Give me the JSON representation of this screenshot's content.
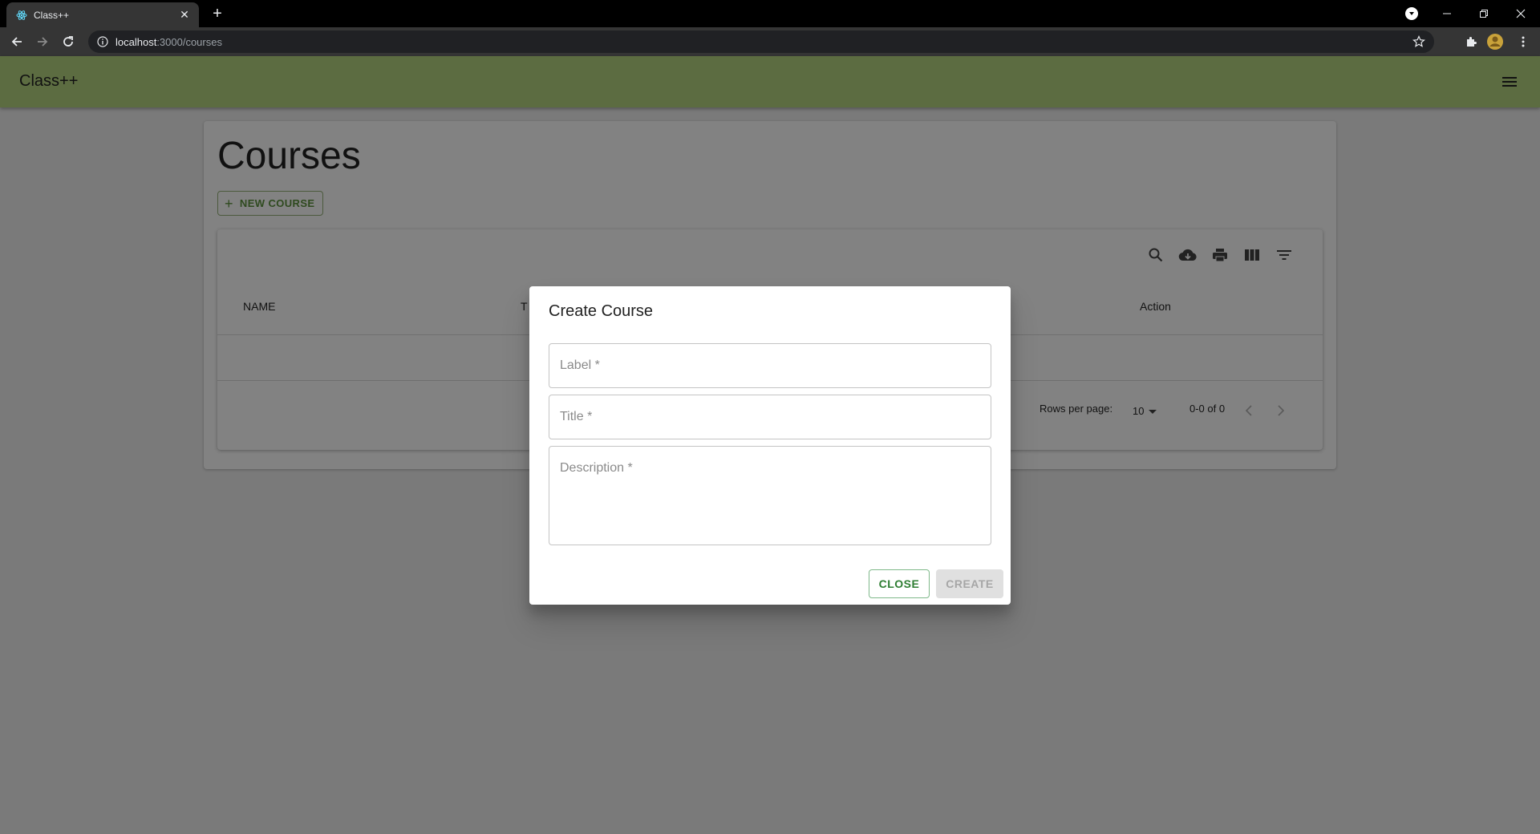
{
  "browser": {
    "tab_title": "Class++",
    "url_host": "localhost",
    "url_path": ":3000/courses"
  },
  "app": {
    "brand": "Class++",
    "accent": "#5c6c41"
  },
  "page": {
    "title": "Courses",
    "new_button": "NEW COURSE"
  },
  "table": {
    "columns": [
      "NAME",
      "T",
      "Action"
    ],
    "rows_per_page_label": "Rows per page:",
    "rows_per_page_value": "10",
    "range": "0-0 of 0",
    "tools": [
      "search-icon",
      "cloud-download-icon",
      "print-icon",
      "view-column-icon",
      "filter-icon"
    ]
  },
  "dialog": {
    "title": "Create Course",
    "label_placeholder": "Label *",
    "title_placeholder": "Title *",
    "description_placeholder": "Description *",
    "close_label": "CLOSE",
    "create_label": "CREATE"
  }
}
